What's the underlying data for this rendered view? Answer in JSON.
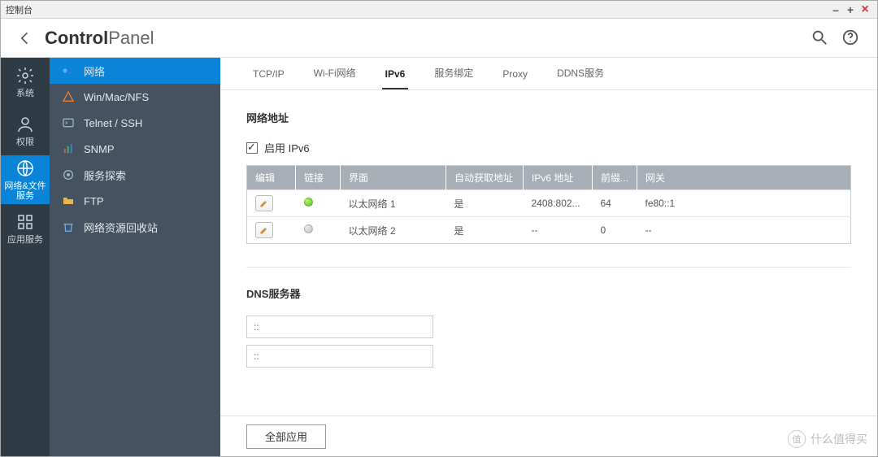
{
  "titlebar": {
    "title": "控制台"
  },
  "header": {
    "brandBold": "Control",
    "brandLight": "Panel"
  },
  "rail": {
    "items": [
      {
        "label": "系统"
      },
      {
        "label": "权限"
      },
      {
        "label": "网络&文件服务"
      },
      {
        "label": "应用服务"
      }
    ],
    "activeIndex": 2
  },
  "sidebar": {
    "items": [
      {
        "label": "网络"
      },
      {
        "label": "Win/Mac/NFS"
      },
      {
        "label": "Telnet / SSH"
      },
      {
        "label": "SNMP"
      },
      {
        "label": "服务探索"
      },
      {
        "label": "FTP"
      },
      {
        "label": "网络资源回收站"
      }
    ],
    "activeIndex": 0
  },
  "tabs": {
    "items": [
      "TCP/IP",
      "Wi-Fi网络",
      "IPv6",
      "服务绑定",
      "Proxy",
      "DDNS服务"
    ],
    "activeIndex": 2
  },
  "sections": {
    "networkAddress": {
      "title": "网络地址",
      "enableLabel": "启用 IPv6",
      "enableChecked": true,
      "table": {
        "headers": [
          "编辑",
          "链接",
          "界面",
          "自动获取地址",
          "IPv6 地址",
          "前缀...",
          "网关"
        ],
        "rows": [
          {
            "status": "green",
            "iface": "以太网络 1",
            "auto": "是",
            "addr": "2408:802...",
            "prefix": "64",
            "gw": "fe80::1"
          },
          {
            "status": "gray",
            "iface": "以太网络 2",
            "auto": "是",
            "addr": "--",
            "prefix": "0",
            "gw": "--"
          }
        ]
      }
    },
    "dns": {
      "title": "DNS服务器",
      "inputs": [
        "::",
        "::"
      ]
    }
  },
  "footer": {
    "applyLabel": "全部应用"
  },
  "watermark": {
    "badge": "值",
    "text": "什么值得买"
  }
}
